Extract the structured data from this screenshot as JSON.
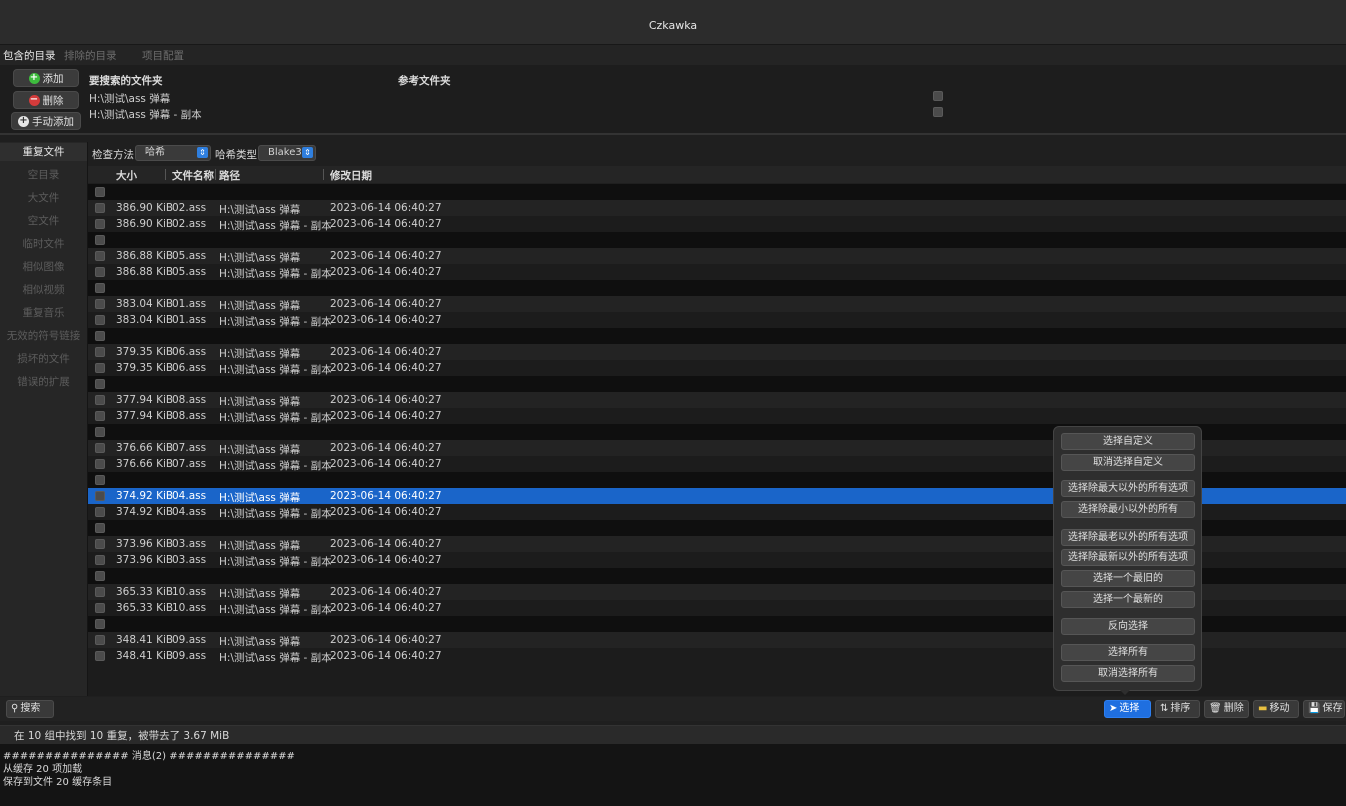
{
  "window": {
    "title": "Czkawka"
  },
  "dir_tabs": [
    {
      "label": "包含的目录"
    },
    {
      "label": "排除的目录"
    },
    {
      "label": "项目配置"
    }
  ],
  "dir_buttons": {
    "add": "添加",
    "remove": "删除",
    "manual_add": "手动添加"
  },
  "dir_headers": {
    "folders": "要搜索的文件夹",
    "reference": "参考文件夹"
  },
  "directories": [
    {
      "path": "H:\\测试\\ass 弹幕"
    },
    {
      "path": "H:\\测试\\ass 弹幕 - 副本"
    }
  ],
  "sidebar": {
    "items": [
      {
        "label": "重复文件"
      },
      {
        "label": "空目录"
      },
      {
        "label": "大文件"
      },
      {
        "label": "空文件"
      },
      {
        "label": "临时文件"
      },
      {
        "label": "相似图像"
      },
      {
        "label": "相似视频"
      },
      {
        "label": "重复音乐"
      },
      {
        "label": "无效的符号链接"
      },
      {
        "label": "损坏的文件"
      },
      {
        "label": "错误的扩展"
      }
    ]
  },
  "toolbar": {
    "method_label": "检查方法",
    "method_value": "哈希",
    "hash_label": "哈希类型",
    "hash_value": "Blake3"
  },
  "columns": {
    "size": "大小",
    "name": "文件名称",
    "path": "路径",
    "date": "修改日期"
  },
  "groups": [
    {
      "files": [
        {
          "size": "386.90 KiB",
          "name": "02.ass",
          "path": "H:\\测试\\ass 弹幕",
          "date": "2023-06-14 06:40:27"
        },
        {
          "size": "386.90 KiB",
          "name": "02.ass",
          "path": "H:\\测试\\ass 弹幕 - 副本",
          "date": "2023-06-14 06:40:27"
        }
      ]
    },
    {
      "files": [
        {
          "size": "386.88 KiB",
          "name": "05.ass",
          "path": "H:\\测试\\ass 弹幕",
          "date": "2023-06-14 06:40:27"
        },
        {
          "size": "386.88 KiB",
          "name": "05.ass",
          "path": "H:\\测试\\ass 弹幕 - 副本",
          "date": "2023-06-14 06:40:27"
        }
      ]
    },
    {
      "files": [
        {
          "size": "383.04 KiB",
          "name": "01.ass",
          "path": "H:\\测试\\ass 弹幕",
          "date": "2023-06-14 06:40:27"
        },
        {
          "size": "383.04 KiB",
          "name": "01.ass",
          "path": "H:\\测试\\ass 弹幕 - 副本",
          "date": "2023-06-14 06:40:27"
        }
      ]
    },
    {
      "files": [
        {
          "size": "379.35 KiB",
          "name": "06.ass",
          "path": "H:\\测试\\ass 弹幕",
          "date": "2023-06-14 06:40:27"
        },
        {
          "size": "379.35 KiB",
          "name": "06.ass",
          "path": "H:\\测试\\ass 弹幕 - 副本",
          "date": "2023-06-14 06:40:27"
        }
      ]
    },
    {
      "files": [
        {
          "size": "377.94 KiB",
          "name": "08.ass",
          "path": "H:\\测试\\ass 弹幕",
          "date": "2023-06-14 06:40:27"
        },
        {
          "size": "377.94 KiB",
          "name": "08.ass",
          "path": "H:\\测试\\ass 弹幕 - 副本",
          "date": "2023-06-14 06:40:27"
        }
      ]
    },
    {
      "files": [
        {
          "size": "376.66 KiB",
          "name": "07.ass",
          "path": "H:\\测试\\ass 弹幕",
          "date": "2023-06-14 06:40:27"
        },
        {
          "size": "376.66 KiB",
          "name": "07.ass",
          "path": "H:\\测试\\ass 弹幕 - 副本",
          "date": "2023-06-14 06:40:27"
        }
      ]
    },
    {
      "files": [
        {
          "size": "374.92 KiB",
          "name": "04.ass",
          "path": "H:\\测试\\ass 弹幕",
          "date": "2023-06-14 06:40:27",
          "selected": true
        },
        {
          "size": "374.92 KiB",
          "name": "04.ass",
          "path": "H:\\测试\\ass 弹幕 - 副本",
          "date": "2023-06-14 06:40:27"
        }
      ]
    },
    {
      "files": [
        {
          "size": "373.96 KiB",
          "name": "03.ass",
          "path": "H:\\测试\\ass 弹幕",
          "date": "2023-06-14 06:40:27"
        },
        {
          "size": "373.96 KiB",
          "name": "03.ass",
          "path": "H:\\测试\\ass 弹幕 - 副本",
          "date": "2023-06-14 06:40:27"
        }
      ]
    },
    {
      "files": [
        {
          "size": "365.33 KiB",
          "name": "10.ass",
          "path": "H:\\测试\\ass 弹幕",
          "date": "2023-06-14 06:40:27"
        },
        {
          "size": "365.33 KiB",
          "name": "10.ass",
          "path": "H:\\测试\\ass 弹幕 - 副本",
          "date": "2023-06-14 06:40:27"
        }
      ]
    },
    {
      "files": [
        {
          "size": "348.41 KiB",
          "name": "09.ass",
          "path": "H:\\测试\\ass 弹幕",
          "date": "2023-06-14 06:40:27"
        },
        {
          "size": "348.41 KiB",
          "name": "09.ass",
          "path": "H:\\测试\\ass 弹幕 - 副本",
          "date": "2023-06-14 06:40:27"
        }
      ]
    }
  ],
  "select_popover": {
    "items": [
      {
        "label": "选择自定义"
      },
      {
        "label": "取消选择自定义"
      },
      {
        "label": "选择除最大以外的所有选项"
      },
      {
        "label": "选择除最小以外的所有"
      },
      {
        "label": "选择除最老以外的所有选项"
      },
      {
        "label": "选择除最新以外的所有选项"
      },
      {
        "label": "选择一个最旧的"
      },
      {
        "label": "选择一个最新的"
      },
      {
        "label": "反向选择"
      },
      {
        "label": "选择所有"
      },
      {
        "label": "取消选择所有"
      }
    ]
  },
  "bottom": {
    "search": "搜索",
    "select": "选择",
    "sort": "排序",
    "delete": "删除",
    "move": "移动",
    "save": "保存"
  },
  "status": {
    "text": "在 10 组中找到 10 重复，被带去了 3.67 MiB"
  },
  "log": [
    "############### 消息(2) ###############",
    "从缓存 20 项加载",
    "保存到文件 20 缓存条目"
  ],
  "colors": {
    "accent": "#1f6fe0",
    "selected_row": "#1a65c9",
    "add_icon": "#3dbb3d",
    "remove_icon": "#d43b3b"
  }
}
